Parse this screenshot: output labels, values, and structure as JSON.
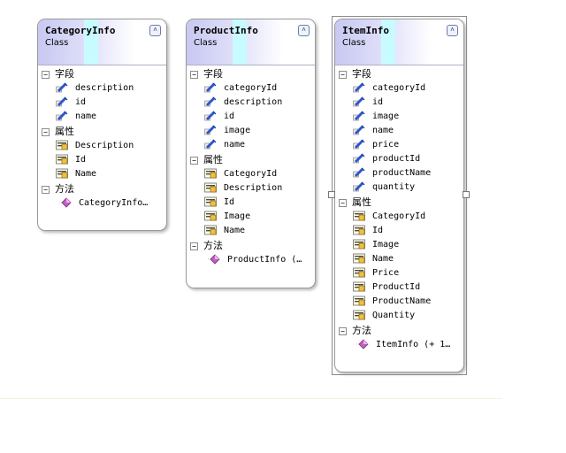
{
  "colors": {
    "header_left": "#c8c8f2",
    "header_cyan": "#c8fbff",
    "border": "#9a9a9a",
    "field_icon": "#2f56c8",
    "method_icon": "#c060c0"
  },
  "classes": [
    {
      "name": "CategoryInfo",
      "stereotype": "Class",
      "collapse_icon": "double-chevron-up",
      "sections": [
        {
          "label": "字段",
          "kind": "field",
          "items": [
            "description",
            "id",
            "name"
          ]
        },
        {
          "label": "属性",
          "kind": "property",
          "items": [
            "Description",
            "Id",
            "Name"
          ]
        },
        {
          "label": "方法",
          "kind": "method",
          "items": [
            "CategoryInfo…"
          ]
        }
      ]
    },
    {
      "name": "ProductInfo",
      "stereotype": "Class",
      "collapse_icon": "double-chevron-up",
      "sections": [
        {
          "label": "字段",
          "kind": "field",
          "items": [
            "categoryId",
            "description",
            "id",
            "image",
            "name"
          ]
        },
        {
          "label": "属性",
          "kind": "property",
          "items": [
            "CategoryId",
            "Description",
            "Id",
            "Image",
            "Name"
          ]
        },
        {
          "label": "方法",
          "kind": "method",
          "items": [
            "ProductInfo  (…"
          ]
        }
      ]
    },
    {
      "name": "ItemInfo",
      "stereotype": "Class",
      "collapse_icon": "double-chevron-up",
      "selected": true,
      "sections": [
        {
          "label": "字段",
          "kind": "field",
          "items": [
            "categoryId",
            "id",
            "image",
            "name",
            "price",
            "productId",
            "productName",
            "quantity"
          ]
        },
        {
          "label": "属性",
          "kind": "property",
          "items": [
            "CategoryId",
            "Id",
            "Image",
            "Name",
            "Price",
            "ProductId",
            "ProductName",
            "Quantity"
          ]
        },
        {
          "label": "方法",
          "kind": "method",
          "items": [
            "ItemInfo  (+ 1…"
          ]
        }
      ]
    }
  ]
}
